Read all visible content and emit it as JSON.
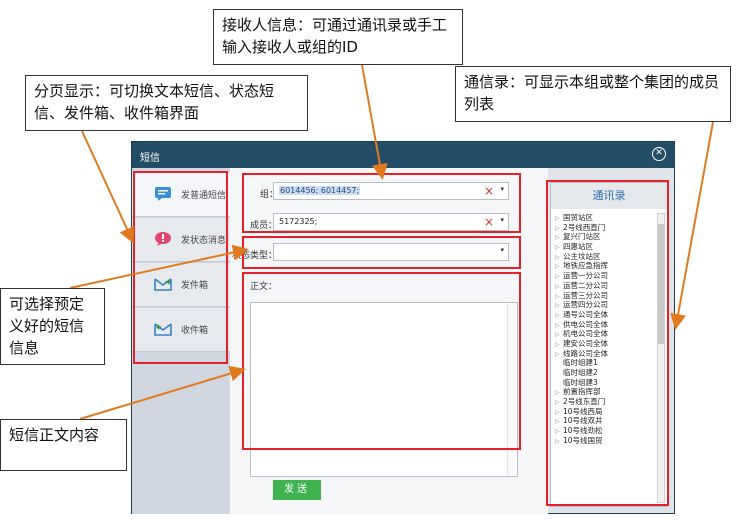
{
  "callouts": {
    "receiver": "接收人信息：可通过通讯录或手工输入接收人或组的ID",
    "tabs": "分页显示：可切换文本短信、状态短信、发件箱、收件箱界面",
    "contacts": "通信录：可显示本组或整个集团的成员列表",
    "preset": "可选择预定义好的短信信息",
    "body": "短信正文内容"
  },
  "window": {
    "title": "短信",
    "close_icon": "close-circle-icon"
  },
  "sidebar": {
    "items": [
      {
        "label": "发普通短信",
        "icon": "message-icon"
      },
      {
        "label": "发状态消息",
        "icon": "status-message-icon"
      },
      {
        "label": "发件箱",
        "icon": "outbox-icon"
      },
      {
        "label": "收件箱",
        "icon": "inbox-icon"
      }
    ]
  },
  "form": {
    "group_label": "组：",
    "group_value": "6014456; 6014457;",
    "member_label": "成员：",
    "member_value": "5172325;",
    "status_type_label": "状态类型：",
    "status_type_value": "",
    "body_label": "正文：",
    "body_value": "",
    "send_label": "发送",
    "clear_icon": "×",
    "dropdown_icon": "▾"
  },
  "contacts": {
    "title": "通讯录",
    "items": [
      {
        "label": "国贸站区",
        "expandable": true
      },
      {
        "label": "2号线西直门",
        "expandable": true
      },
      {
        "label": "复兴门站区",
        "expandable": true
      },
      {
        "label": "四惠站区",
        "expandable": true
      },
      {
        "label": "公主坟站区",
        "expandable": true
      },
      {
        "label": "地铁应急指挥",
        "expandable": true
      },
      {
        "label": "运营一分公司",
        "expandable": true
      },
      {
        "label": "运营二分公司",
        "expandable": true
      },
      {
        "label": "运营三分公司",
        "expandable": true
      },
      {
        "label": "运营四分公司",
        "expandable": true
      },
      {
        "label": "通号公司全体",
        "expandable": true
      },
      {
        "label": "供电公司全体",
        "expandable": true
      },
      {
        "label": "机电公司全体",
        "expandable": true
      },
      {
        "label": "建安公司全体",
        "expandable": true
      },
      {
        "label": "线路公司全体",
        "expandable": true
      },
      {
        "label": "临时组建1",
        "expandable": false
      },
      {
        "label": "临时组建2",
        "expandable": false
      },
      {
        "label": "临时组建3",
        "expandable": false
      },
      {
        "label": "前置指挥部",
        "expandable": true
      },
      {
        "label": "2号线东直门",
        "expandable": true
      },
      {
        "label": "10号线西局",
        "expandable": true
      },
      {
        "label": "10号线双井",
        "expandable": true
      },
      {
        "label": "10号线劲松",
        "expandable": true
      },
      {
        "label": "10号线国贸",
        "expandable": true
      }
    ]
  },
  "colors": {
    "titlebar": "#224d66",
    "highlight": "#e8202a",
    "annotation_arrow": "#e07a1f",
    "send_button": "#3fb34f",
    "contacts_title": "#2e6fb5",
    "clear_icon": "#d0342c"
  }
}
